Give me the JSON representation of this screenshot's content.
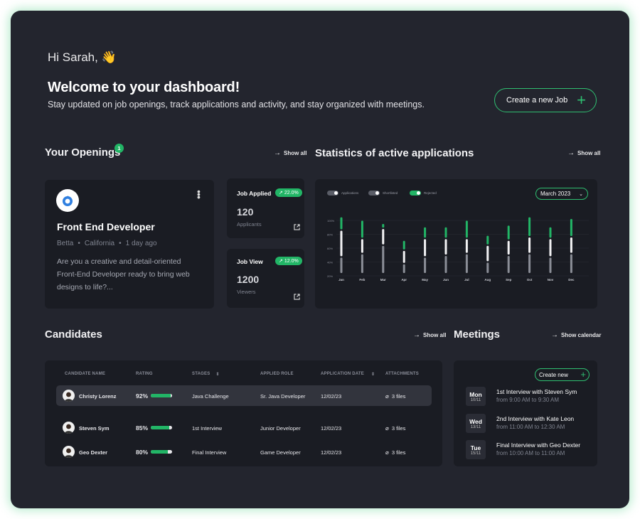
{
  "header": {
    "greeting": "Hi Sarah, 👋",
    "title": "Welcome to your dashboard!",
    "subtitle": "Stay updated on job openings, track applications and activity, and stay organized with meetings.",
    "create_job_label": "Create a new Job"
  },
  "openings": {
    "title": "Your Openings",
    "count": "1",
    "show_all": "Show all",
    "job": {
      "title": "Front End Developer",
      "company": "Betta",
      "location": "California",
      "posted": "1 day ago",
      "description": "Are you a creative and detail-oriented Front-End Developer ready to bring web designs to life?..."
    }
  },
  "stats_cards": [
    {
      "label": "Job Applied",
      "change": "22.0%",
      "value": "120",
      "sub": "Applicants"
    },
    {
      "label": "Job View",
      "change": "12.0%",
      "value": "1200",
      "sub": "Viewers"
    }
  ],
  "statistics": {
    "title": "Statistics of active applications",
    "show_all": "Show all",
    "legend": [
      "Applications",
      "Shortlisted",
      "Rejected"
    ],
    "month": "March 2023",
    "y_ticks": [
      "100%",
      "80%",
      "60%",
      "40%",
      "20%"
    ],
    "months": [
      "Jan",
      "Feb",
      "Mar",
      "Apr",
      "May",
      "Jun",
      "Jul",
      "Aug",
      "Sep",
      "Oct",
      "Nov",
      "Dec"
    ],
    "applications": [
      0.5,
      0.6,
      0.85,
      0.3,
      0.5,
      0.55,
      0.6,
      0.35,
      0.55,
      0.6,
      0.5,
      0.6
    ],
    "shortlisted": [
      0.8,
      0.45,
      0.5,
      0.4,
      0.55,
      0.5,
      0.45,
      0.5,
      0.45,
      0.5,
      0.55,
      0.5
    ],
    "rejected": [
      0.4,
      0.55,
      0.15,
      0.3,
      0.35,
      0.35,
      0.55,
      0.3,
      0.45,
      0.6,
      0.35,
      0.55
    ]
  },
  "candidates": {
    "title": "Candidates",
    "show_all": "Show all",
    "columns": [
      "CANDIDATE NAME",
      "RATING",
      "STAGES",
      "APPLIED ROLE",
      "APPLICATION DATE",
      "ATTACHMENTS"
    ],
    "rows": [
      {
        "name": "Christy Lorenz",
        "rating": "92%",
        "rating_value": 92,
        "stage": "Java Challenge",
        "role": "Sr. Java Developer",
        "date": "12/02/23",
        "attachments": "3 files"
      },
      {
        "name": "Steven Sym",
        "rating": "85%",
        "rating_value": 85,
        "stage": "1st Interview",
        "role": "Junior  Developer",
        "date": "12/02/23",
        "attachments": "3 files"
      },
      {
        "name": "Geo Dexter",
        "rating": "80%",
        "rating_value": 80,
        "stage": "Final  Interview",
        "role": "Game  Developer",
        "date": "12/02/23",
        "attachments": "3 files"
      }
    ]
  },
  "meetings": {
    "title": "Meetings",
    "show_calendar": "Show calendar",
    "create_new": "Create new",
    "items": [
      {
        "day": "Mon",
        "date": "10/11",
        "title": "1st Interview with Steven Sym",
        "time": "from 9:00 AM to 9:30 AM"
      },
      {
        "day": "Wed",
        "date": "13/11",
        "title": "2nd Interview with Kate Leon",
        "time": "from 11:00 AM to 12:30 AM"
      },
      {
        "day": "Tue",
        "date": "15/11",
        "title": "Final Interview with Geo Dexter",
        "time": "from 10:00 AM to 11:00 AM"
      }
    ]
  },
  "colors": {
    "accent": "#22b566",
    "background": "#23252e",
    "card": "#1a1c23"
  }
}
